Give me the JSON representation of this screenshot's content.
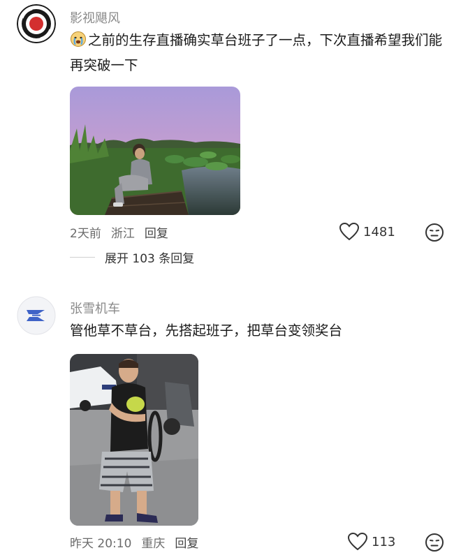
{
  "comments": [
    {
      "username": "影视飓风",
      "emoji": "crying-face-emoji",
      "text": "之前的生存直播确实草台班子了一点，下次直播希望我们能再突破一下",
      "time": "2天前",
      "location": "浙江",
      "reply_label": "回复",
      "likes": "1481",
      "expand_label": "展开 103 条回复"
    },
    {
      "username": "张雪机车",
      "text": "管他草不草台，先搭起班子，把草台变领奖台",
      "time": "昨天 20:10",
      "location": "重庆",
      "reply_label": "回复",
      "likes": "113"
    }
  ],
  "icons": {
    "like": "heart-icon",
    "dislike": "meh-face-icon",
    "avatar1": "red-eye-logo",
    "avatar2": "blue-z-logo"
  },
  "colors": {
    "username": "#8a8a8a",
    "text": "#1b1b1b",
    "avatar1_red": "#d32f2f",
    "avatar2_blue": "#3f63c7"
  }
}
